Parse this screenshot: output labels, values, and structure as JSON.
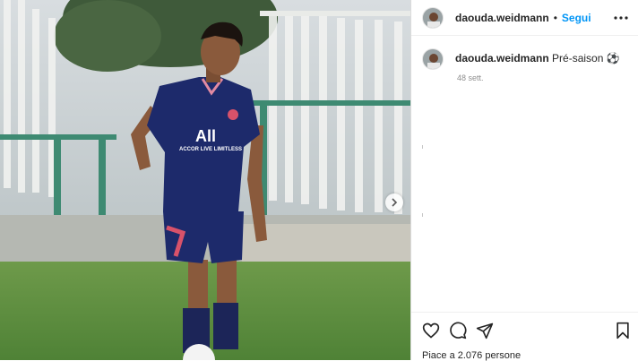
{
  "post": {
    "author": "daouda.weidmann",
    "follow_label": "Segui",
    "separator": "•",
    "caption_text": "Pré-saison",
    "caption_emoji": "⚽",
    "time_ago": "48 sett.",
    "likes_text": "Piace a 2.076 persone"
  },
  "icons": {
    "more": "more-options-icon",
    "like": "heart-icon",
    "comment": "comment-icon",
    "share": "send-icon",
    "save": "bookmark-icon",
    "next": "chevron-right-icon"
  },
  "colors": {
    "accent": "#0095f6",
    "text": "#262626",
    "muted": "#8e8e8e",
    "jersey": "#1d2a6b"
  }
}
